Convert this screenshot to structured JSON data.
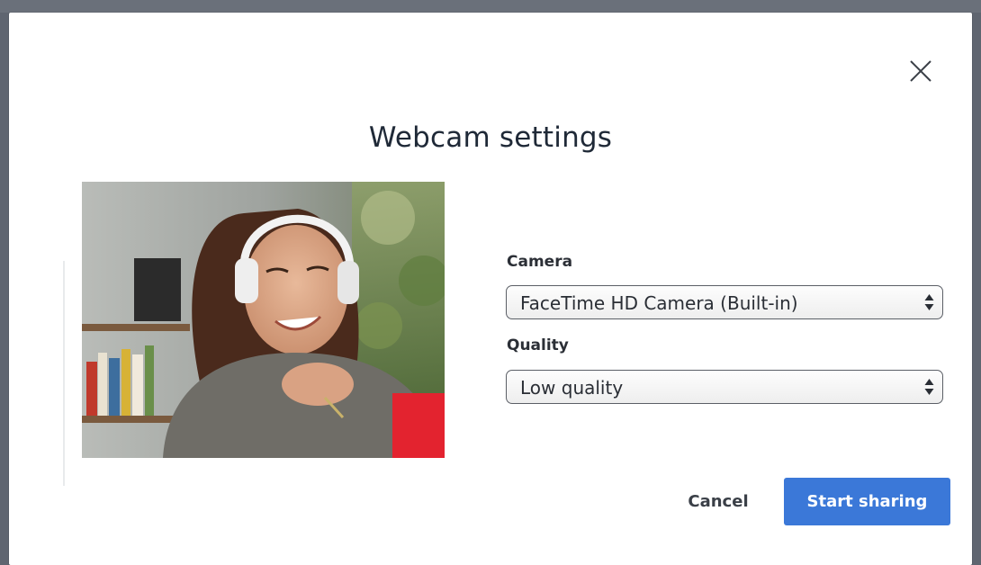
{
  "dialog": {
    "title": "Webcam settings",
    "close_icon": "close-icon"
  },
  "preview": {
    "content": "webcam-preview-image"
  },
  "camera": {
    "label": "Camera",
    "selected": "FaceTime HD Camera (Built-in)",
    "arrow_icon": "select-arrows-icon"
  },
  "quality": {
    "label": "Quality",
    "selected": "Low quality",
    "arrow_icon": "select-arrows-icon"
  },
  "actions": {
    "cancel_label": "Cancel",
    "start_label": "Start sharing"
  },
  "colors": {
    "primary": "#3b78d8",
    "backdrop": "#5f6570",
    "text": "#1f2937"
  }
}
